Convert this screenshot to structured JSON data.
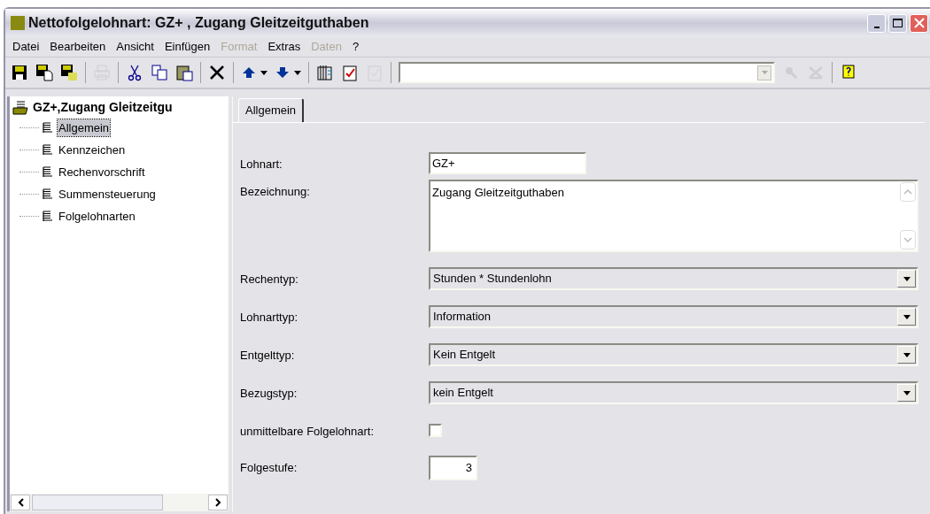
{
  "window": {
    "title": "Nettofolgelohnart: GZ+ , Zugang Gleitzeitguthaben"
  },
  "menu": [
    {
      "label": "Datei",
      "disabled": false
    },
    {
      "label": "Bearbeiten",
      "disabled": false
    },
    {
      "label": "Ansicht",
      "disabled": false
    },
    {
      "label": "Einfügen",
      "disabled": false
    },
    {
      "label": "Format",
      "disabled": true
    },
    {
      "label": "Extras",
      "disabled": false
    },
    {
      "label": "Daten",
      "disabled": true
    },
    {
      "label": "?",
      "disabled": false
    }
  ],
  "toolbar": [
    {
      "kind": "save",
      "disabled": false
    },
    {
      "kind": "save-copy",
      "disabled": false
    },
    {
      "kind": "save-all",
      "disabled": false
    },
    {
      "kind": "separator"
    },
    {
      "kind": "print",
      "disabled": true
    },
    {
      "kind": "separator"
    },
    {
      "kind": "cut",
      "disabled": false
    },
    {
      "kind": "copy",
      "disabled": false
    },
    {
      "kind": "paste",
      "disabled": false
    },
    {
      "kind": "separator"
    },
    {
      "kind": "delete",
      "disabled": false
    },
    {
      "kind": "separator"
    },
    {
      "kind": "up",
      "disabled": false
    },
    {
      "kind": "down",
      "disabled": false
    },
    {
      "kind": "separator"
    },
    {
      "kind": "binder",
      "disabled": false
    },
    {
      "kind": "checklist",
      "disabled": false
    },
    {
      "kind": "approve",
      "disabled": true
    },
    {
      "kind": "separator"
    },
    {
      "kind": "combo",
      "disabled": false
    },
    {
      "kind": "search",
      "disabled": true
    },
    {
      "kind": "clear",
      "disabled": true
    },
    {
      "kind": "separator"
    },
    {
      "kind": "help",
      "disabled": false
    }
  ],
  "tree": {
    "label": "GZ+,Zugang Gleitzeitgu",
    "children": [
      {
        "label": "Allgemein",
        "selected": true
      },
      {
        "label": "Kennzeichen",
        "selected": false
      },
      {
        "label": "Rechenvorschrift",
        "selected": false
      },
      {
        "label": "Summensteuerung",
        "selected": false
      },
      {
        "label": "Folgelohnarten",
        "selected": false
      }
    ]
  },
  "tabs": [
    {
      "label": "Allgemein",
      "selected": true
    }
  ],
  "fields": [
    {
      "kind": "text",
      "label": "Lohnart:",
      "value": "GZ+"
    },
    {
      "kind": "textarea",
      "label": "Bezeichnung:",
      "value": "Zugang Gleitzeitguthaben"
    },
    {
      "kind": "select",
      "label": "Rechentyp:",
      "value": "Stunden * Stundenlohn"
    },
    {
      "kind": "select",
      "label": "Lohnarttyp:",
      "value": "Information"
    },
    {
      "kind": "select",
      "label": "Entgelttyp:",
      "value": "Kein Entgelt"
    },
    {
      "kind": "select",
      "label": "Bezugstyp:",
      "value": "kein Entgelt"
    },
    {
      "kind": "checkbox",
      "label": "unmittelbare Folgelohnart:",
      "checked": false
    },
    {
      "kind": "number",
      "label": "Folgestufe:",
      "value": "3"
    }
  ]
}
